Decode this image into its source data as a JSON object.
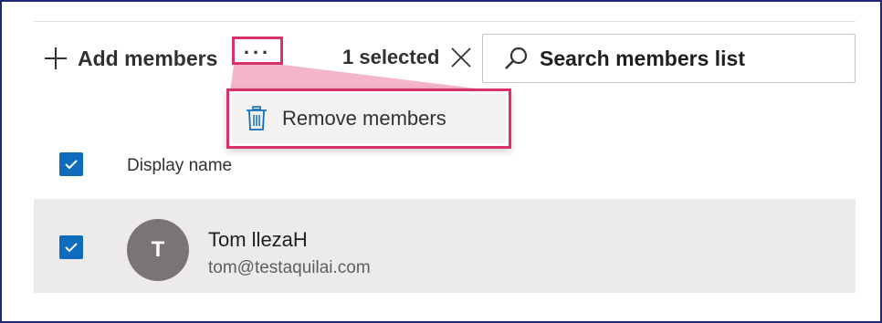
{
  "toolbar": {
    "add_members_label": "Add members",
    "more_label": "...",
    "selected_count": "1 selected",
    "search_placeholder": "Search members list"
  },
  "context_menu": {
    "items": [
      {
        "label": "Remove members",
        "icon": "trash-icon"
      }
    ]
  },
  "list": {
    "columns": [
      "Display name"
    ],
    "header_checked": true,
    "rows": [
      {
        "avatar_initial": "T",
        "name": "Tom llezaH",
        "email": "tom@testaquilai.com",
        "checked": true
      }
    ]
  },
  "colors": {
    "highlight_border": "#d6336c",
    "callout_fill": "#f2a7c3",
    "checkbox_blue": "#0f6cbd",
    "row_selected_bg": "#edebe9",
    "avatar_bg": "#7a7574",
    "frame_border": "#1f2a73"
  }
}
